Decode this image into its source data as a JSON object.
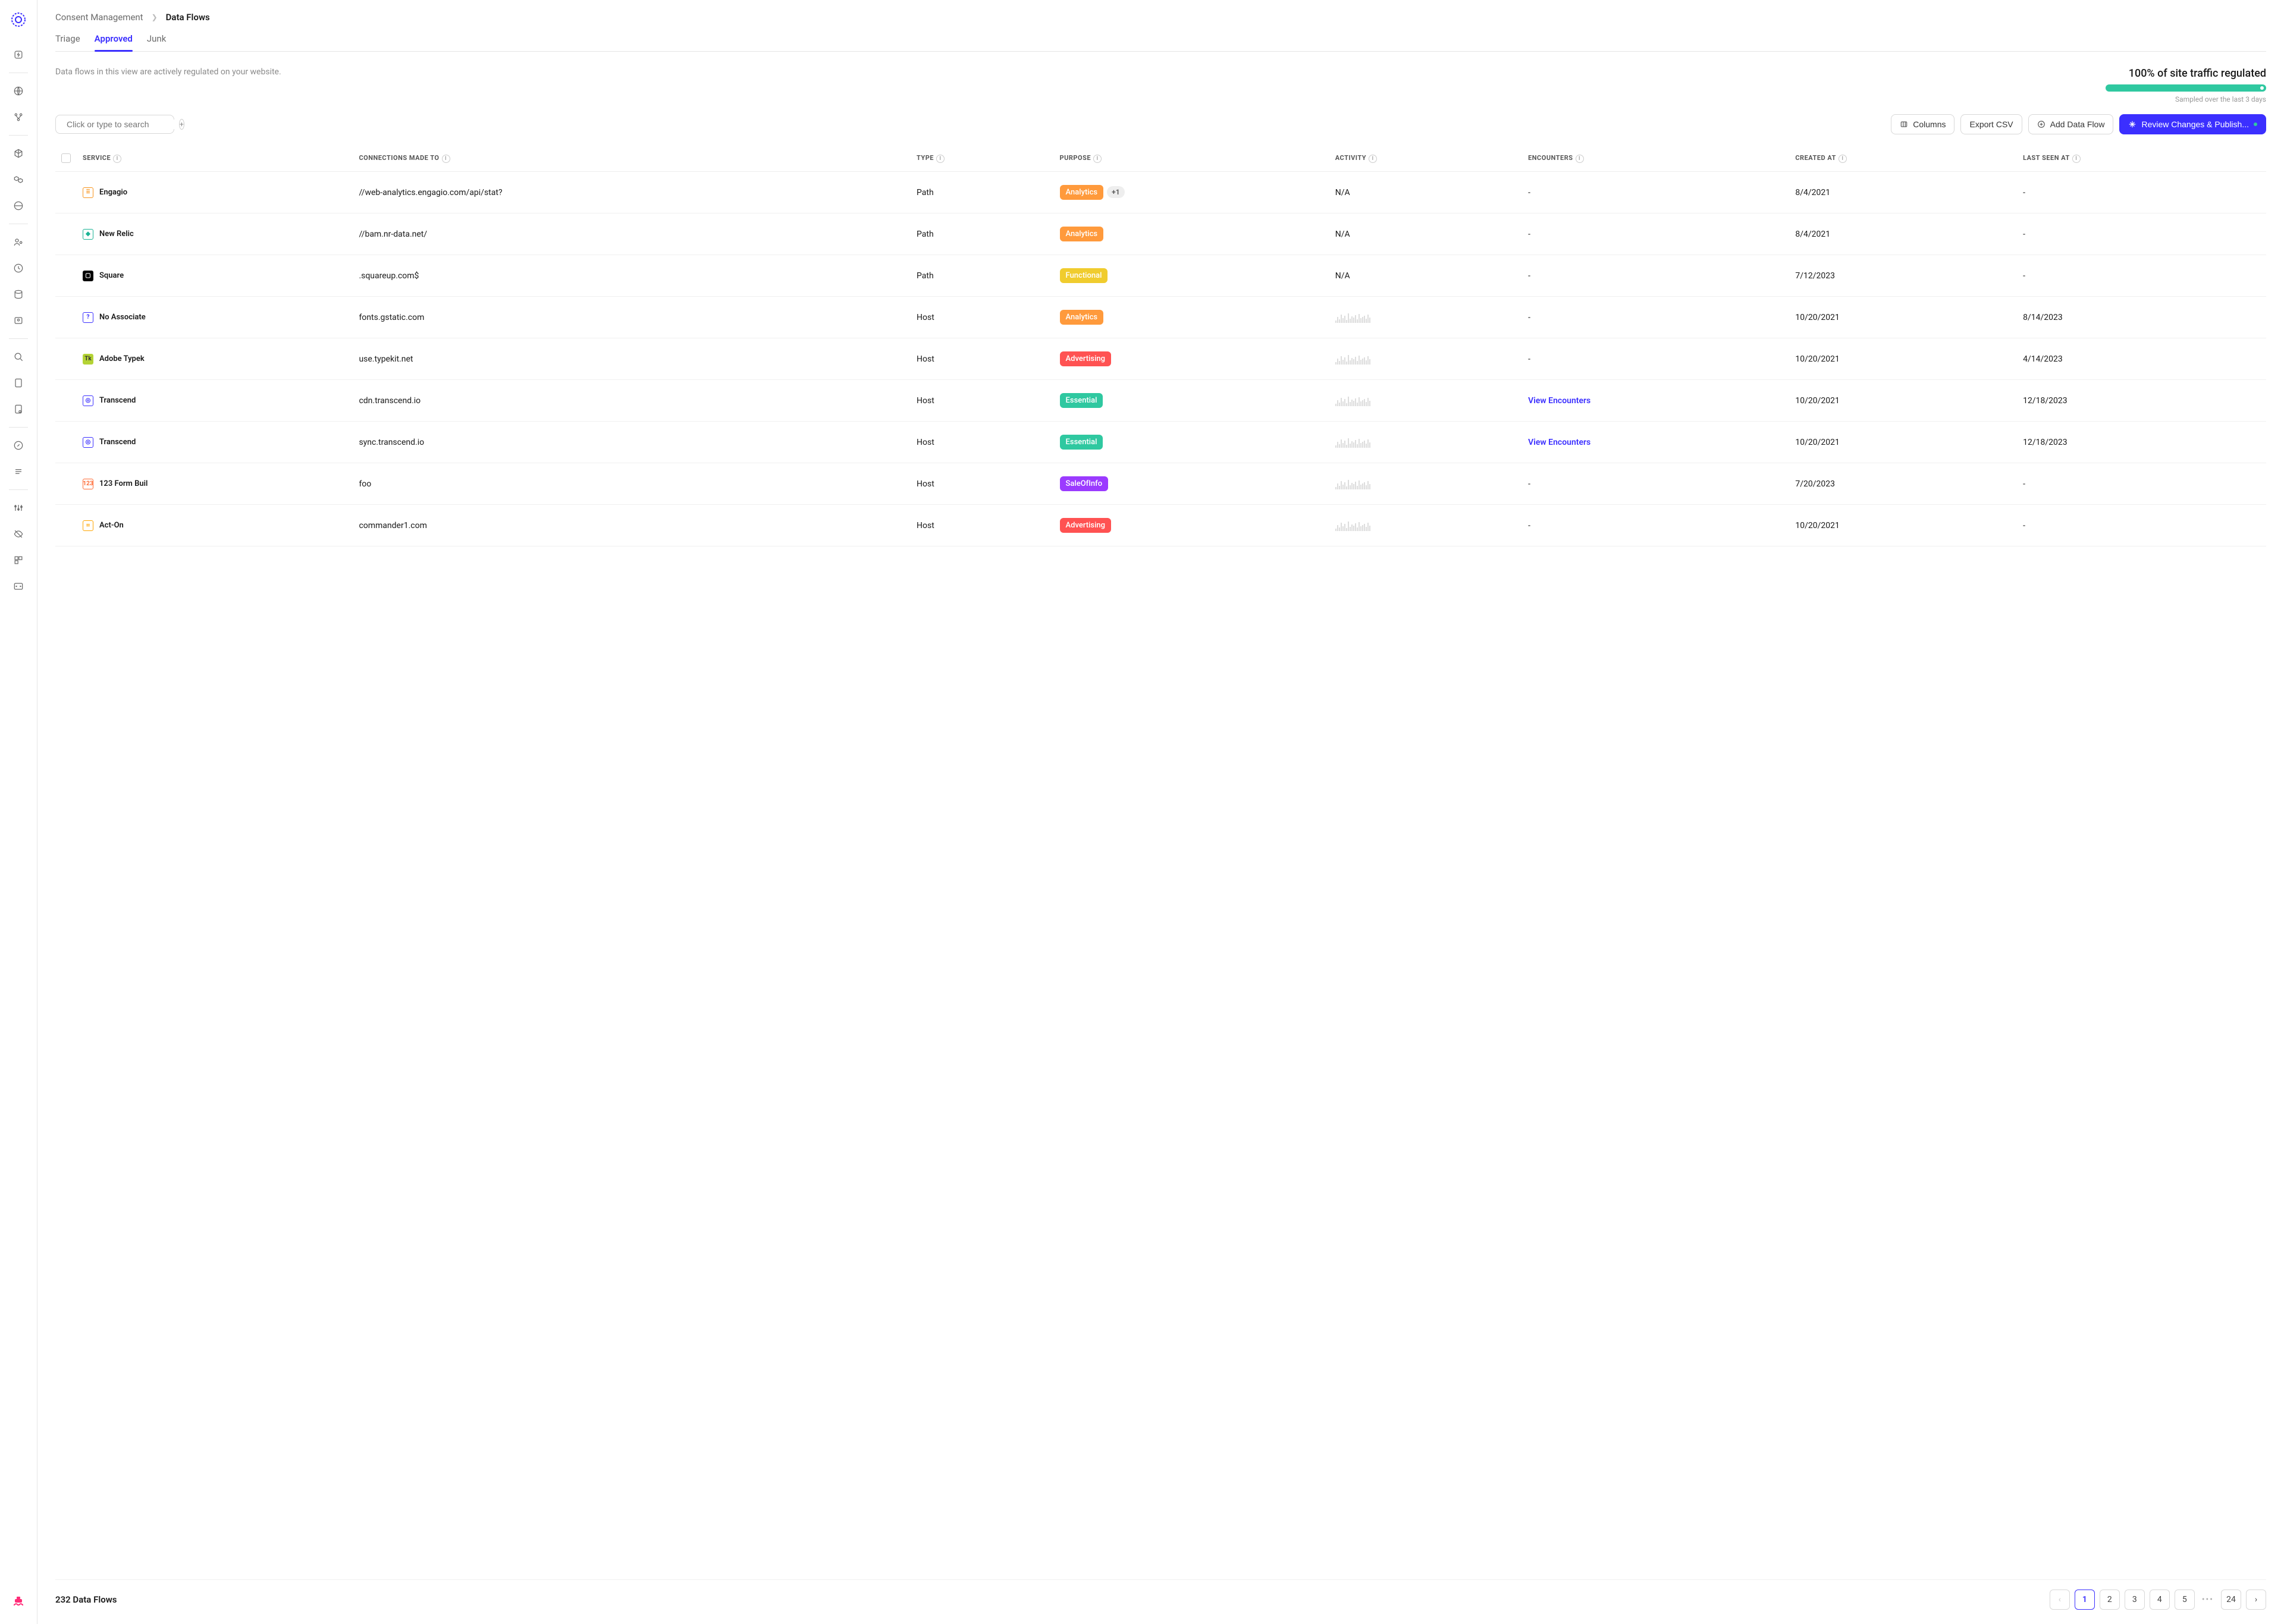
{
  "breadcrumb": {
    "parent": "Consent Management",
    "current": "Data Flows"
  },
  "tabs": [
    {
      "label": "Triage",
      "active": false
    },
    {
      "label": "Approved",
      "active": true
    },
    {
      "label": "Junk",
      "active": false
    }
  ],
  "description": "Data flows in this view are actively regulated on your website.",
  "regulation": {
    "title": "100% of site traffic regulated",
    "sample": "Sampled over the last 3 days"
  },
  "search": {
    "placeholder": "Click or type to search"
  },
  "toolbar": {
    "columns": "Columns",
    "export": "Export CSV",
    "add": "Add Data Flow",
    "review": "Review Changes & Publish..."
  },
  "columns": {
    "service": "Service",
    "connections": "Connections Made To",
    "type": "Type",
    "purpose": "Purpose",
    "activity": "Activity",
    "encounters": "Encounters",
    "created": "Created At",
    "lastseen": "Last Seen At"
  },
  "rows": [
    {
      "service": "Engagio",
      "iconBg": "#fff",
      "iconColor": "#f7941d",
      "iconText": "⠿",
      "connection": "//web-analytics.engagio.com/api/stat?",
      "type": "Path",
      "purpose": "Analytics",
      "purposeClass": "analytics",
      "extra": "+1",
      "activity": "N/A",
      "encounters": "-",
      "created": "8/4/2021",
      "lastseen": "-"
    },
    {
      "service": "New Relic",
      "iconBg": "#fff",
      "iconColor": "#1ab394",
      "iconText": "◆",
      "connection": "//bam.nr-data.net/",
      "type": "Path",
      "purpose": "Analytics",
      "purposeClass": "analytics",
      "extra": "",
      "activity": "N/A",
      "encounters": "-",
      "created": "8/4/2021",
      "lastseen": "-"
    },
    {
      "service": "Square",
      "iconBg": "#000",
      "iconColor": "#fff",
      "iconText": "▢",
      "connection": ".squareup.com$",
      "type": "Path",
      "purpose": "Functional",
      "purposeClass": "functional",
      "extra": "",
      "activity": "N/A",
      "encounters": "-",
      "created": "7/12/2023",
      "lastseen": "-"
    },
    {
      "service": "No Associate",
      "iconBg": "#fff",
      "iconColor": "#3b2fff",
      "iconText": "?",
      "connection": "fonts.gstatic.com",
      "type": "Host",
      "purpose": "Analytics",
      "purposeClass": "analytics",
      "extra": "",
      "activity": "spark",
      "encounters": "-",
      "created": "10/20/2021",
      "lastseen": "8/14/2023"
    },
    {
      "service": "Adobe Typek",
      "iconBg": "#b4d335",
      "iconColor": "#333",
      "iconText": "Tk",
      "connection": "use.typekit.net",
      "type": "Host",
      "purpose": "Advertising",
      "purposeClass": "advertising",
      "extra": "",
      "activity": "spark",
      "encounters": "-",
      "created": "10/20/2021",
      "lastseen": "4/14/2023"
    },
    {
      "service": "Transcend",
      "iconBg": "#fff",
      "iconColor": "#3b2fff",
      "iconText": "◎",
      "connection": "cdn.transcend.io",
      "type": "Host",
      "purpose": "Essential",
      "purposeClass": "essential",
      "extra": "",
      "activity": "spark",
      "encounters": "View Encounters",
      "encountersLink": true,
      "created": "10/20/2021",
      "lastseen": "12/18/2023"
    },
    {
      "service": "Transcend",
      "iconBg": "#fff",
      "iconColor": "#3b2fff",
      "iconText": "◎",
      "connection": "sync.transcend.io",
      "type": "Host",
      "purpose": "Essential",
      "purposeClass": "essential",
      "extra": "",
      "activity": "spark",
      "encounters": "View Encounters",
      "encountersLink": true,
      "created": "10/20/2021",
      "lastseen": "12/18/2023"
    },
    {
      "service": "123 Form Buil",
      "iconBg": "#fff",
      "iconColor": "#ff6b35",
      "iconText": "123",
      "connection": "foo",
      "type": "Host",
      "purpose": "SaleOfInfo",
      "purposeClass": "saleofinfo",
      "extra": "",
      "activity": "spark",
      "encounters": "-",
      "created": "7/20/2023",
      "lastseen": "-"
    },
    {
      "service": "Act-On",
      "iconBg": "#fff",
      "iconColor": "#ffa500",
      "iconText": "⠶",
      "connection": "commander1.com",
      "type": "Host",
      "purpose": "Advertising",
      "purposeClass": "advertising",
      "extra": "",
      "activity": "spark",
      "encounters": "-",
      "created": "10/20/2021",
      "lastseen": "-"
    }
  ],
  "footer": {
    "count": "232 Data Flows"
  },
  "pagination": {
    "pages": [
      "1",
      "2",
      "3",
      "4",
      "5"
    ],
    "last": "24",
    "active": "1"
  }
}
